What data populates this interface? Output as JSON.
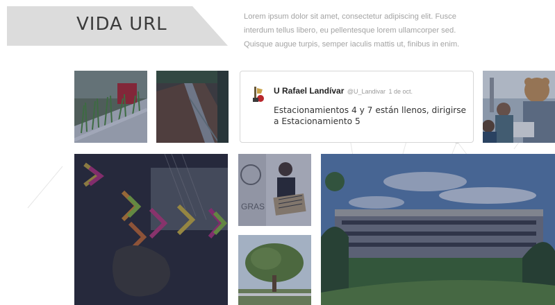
{
  "header": {
    "title": "VIDA URL",
    "intro": "Lorem ipsum dolor sit amet, consectetur adipiscing elit. Fusce interdum tellus libero, eu pellentesque lorem ullamcorper sed. Quisque augue turpis, semper iaculis mattis ut, finibus in enim."
  },
  "tweet": {
    "name": "U Rafael Landívar",
    "handle": "@U_Landivar",
    "date": "1 de oct.",
    "text": "Estacionamientos 4 y 7 están llenos, dirigirse a Estacionamiento 5"
  },
  "tiles": [
    {
      "name": "photo-seedlings"
    },
    {
      "name": "photo-garden-beds"
    },
    {
      "name": "photo-people-mascot"
    },
    {
      "name": "photo-mosaic-art"
    },
    {
      "name": "photo-person-holding-sign"
    },
    {
      "name": "photo-tree"
    },
    {
      "name": "photo-campus-building"
    }
  ],
  "colors": {
    "overlay": "#1c2852",
    "title_bg": "#dcdcdc",
    "title_text": "#3b3b3b",
    "intro_text": "#a3a3a3"
  }
}
